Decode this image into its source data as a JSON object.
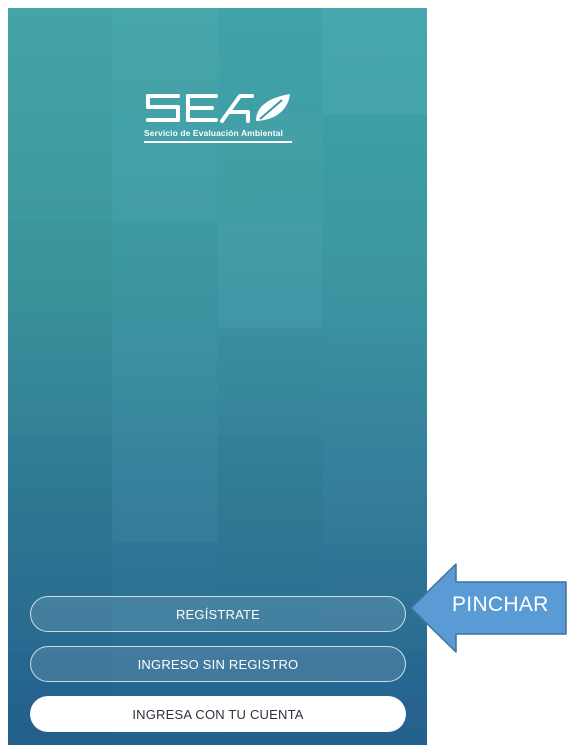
{
  "logo": {
    "letters": "SEA",
    "tagline": "Servicio de Evaluación Ambiental"
  },
  "buttons": {
    "register": "REGÍSTRATE",
    "no_register": "INGRESO SIN REGISTRO",
    "login": "INGRESA CON TU CUENTA"
  },
  "annotation": {
    "label": "PINCHAR",
    "color": "#5b9bd5"
  }
}
